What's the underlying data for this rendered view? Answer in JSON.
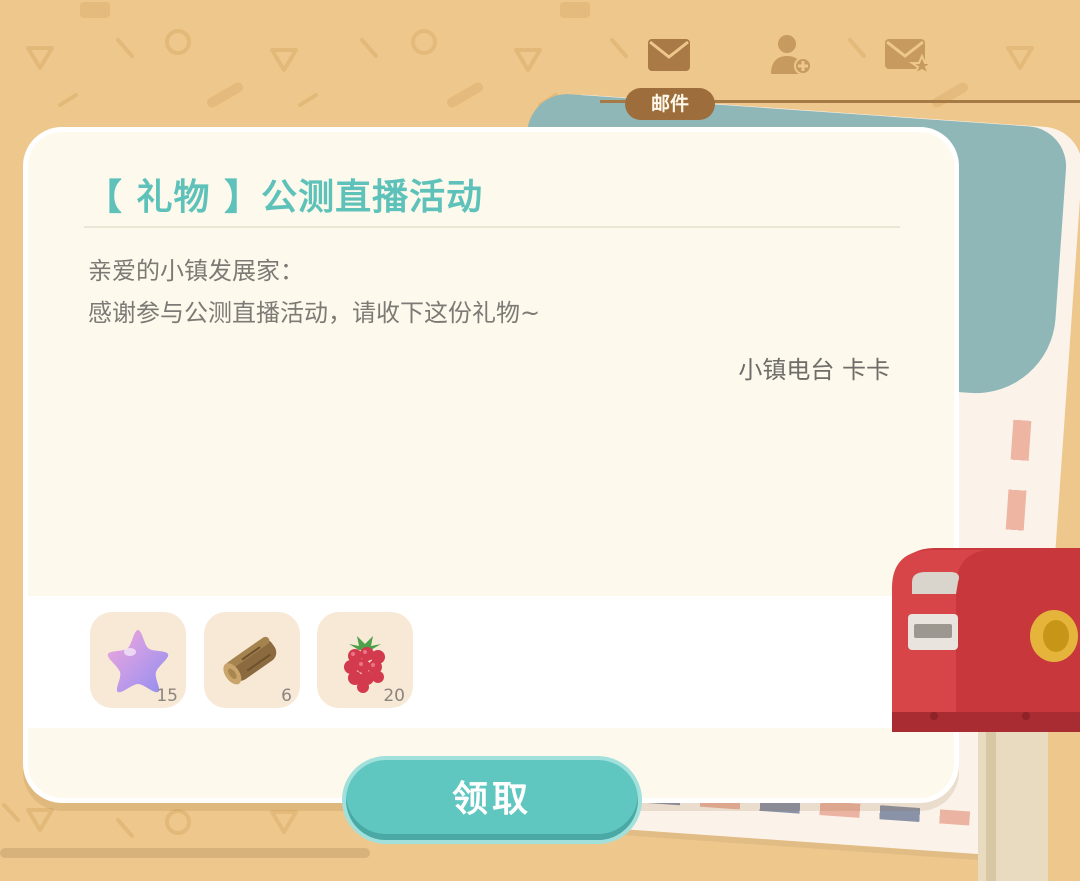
{
  "tabs": {
    "active_label": "邮件",
    "items": [
      {
        "icon": "mail-icon",
        "active": true
      },
      {
        "icon": "add-friend-icon",
        "active": false
      },
      {
        "icon": "starred-mail-icon",
        "active": false
      }
    ]
  },
  "mail": {
    "title": "【 礼物 】公测直播活动",
    "greeting": "亲爱的小镇发展家：",
    "body": "感谢参与公测直播活动，请收下这份礼物~",
    "signature": "小镇电台 卡卡"
  },
  "rewards": [
    {
      "name": "star-icon",
      "count": "15"
    },
    {
      "name": "wood-log-icon",
      "count": "6"
    },
    {
      "name": "raspberry-icon",
      "count": "20"
    }
  ],
  "actions": {
    "claim_label": "领取"
  },
  "colors": {
    "background": "#eec78c",
    "accent": "#5fc6c0",
    "title": "#5ec2bb",
    "tab_label_bg": "#9d6d3b"
  }
}
